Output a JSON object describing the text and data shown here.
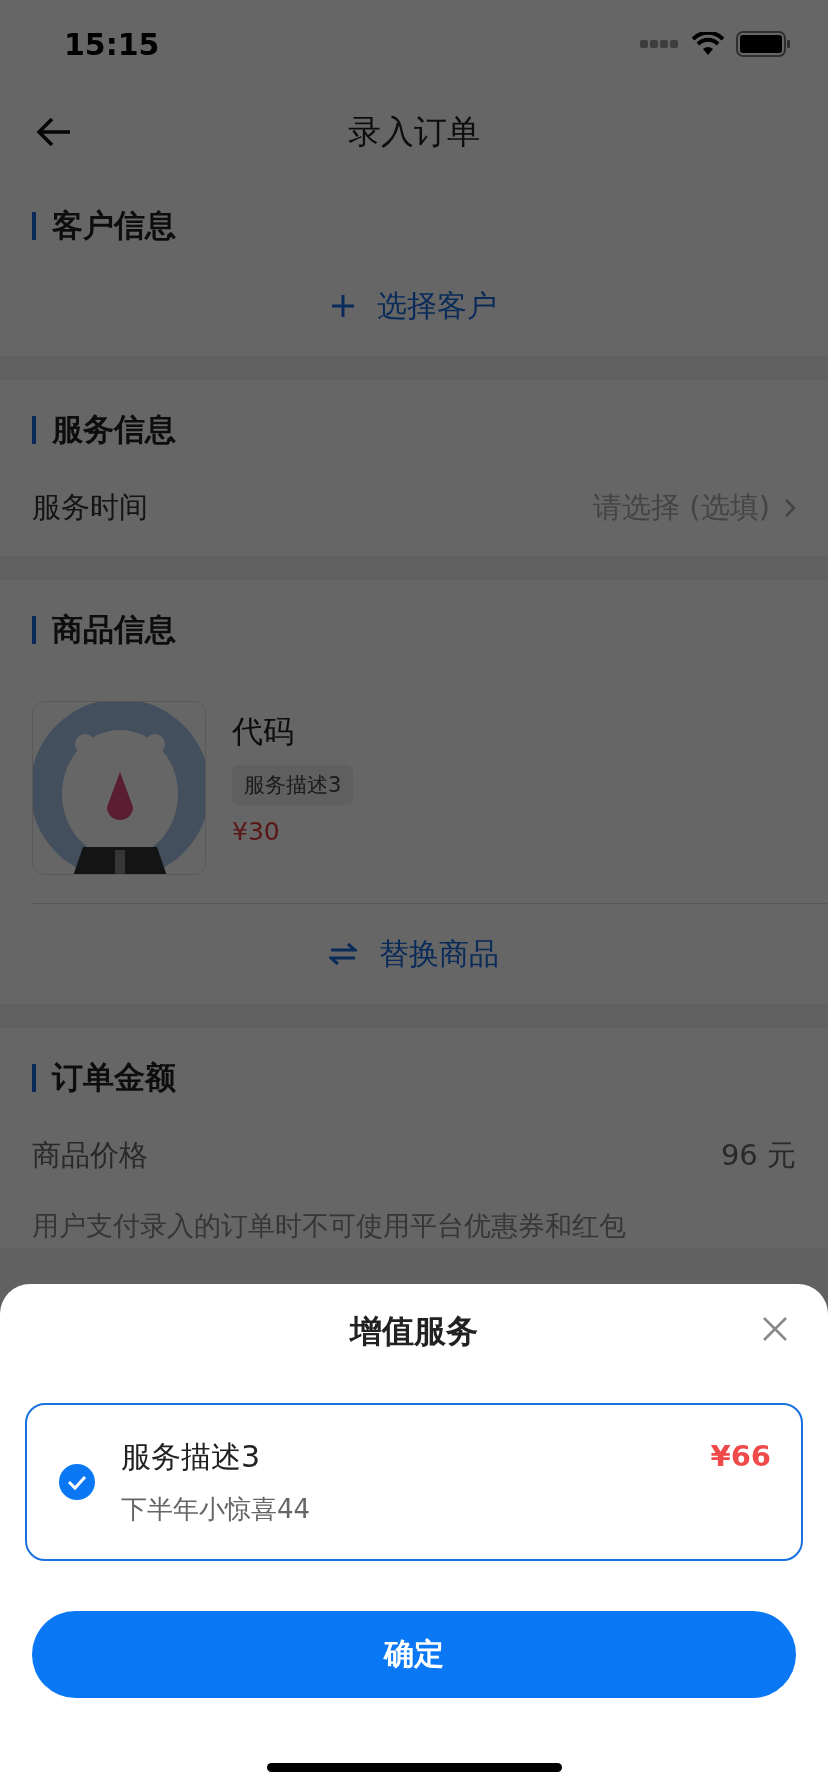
{
  "status_bar": {
    "time": "15:15"
  },
  "nav": {
    "title": "录入订单"
  },
  "customer_section": {
    "title": "客户信息",
    "action": "选择客户"
  },
  "service_section": {
    "title": "服务信息",
    "rows": [
      {
        "label": "服务时间",
        "placeholder": "请选择 (选填)"
      }
    ]
  },
  "product_section": {
    "title": "商品信息",
    "product": {
      "name": "代码",
      "tag": "服务描述3",
      "price": "¥30"
    },
    "action": "替换商品"
  },
  "amount_section": {
    "title": "订单金额",
    "rows": [
      {
        "label": "商品价格",
        "value": "96 元"
      }
    ],
    "note": "用户支付录入的订单时不可使用平台优惠券和红包"
  },
  "sheet": {
    "title": "增值服务",
    "options": [
      {
        "name": "服务描述3",
        "description": "下半年小惊喜44",
        "price": "¥66",
        "selected": true
      }
    ],
    "confirm": "确定"
  }
}
